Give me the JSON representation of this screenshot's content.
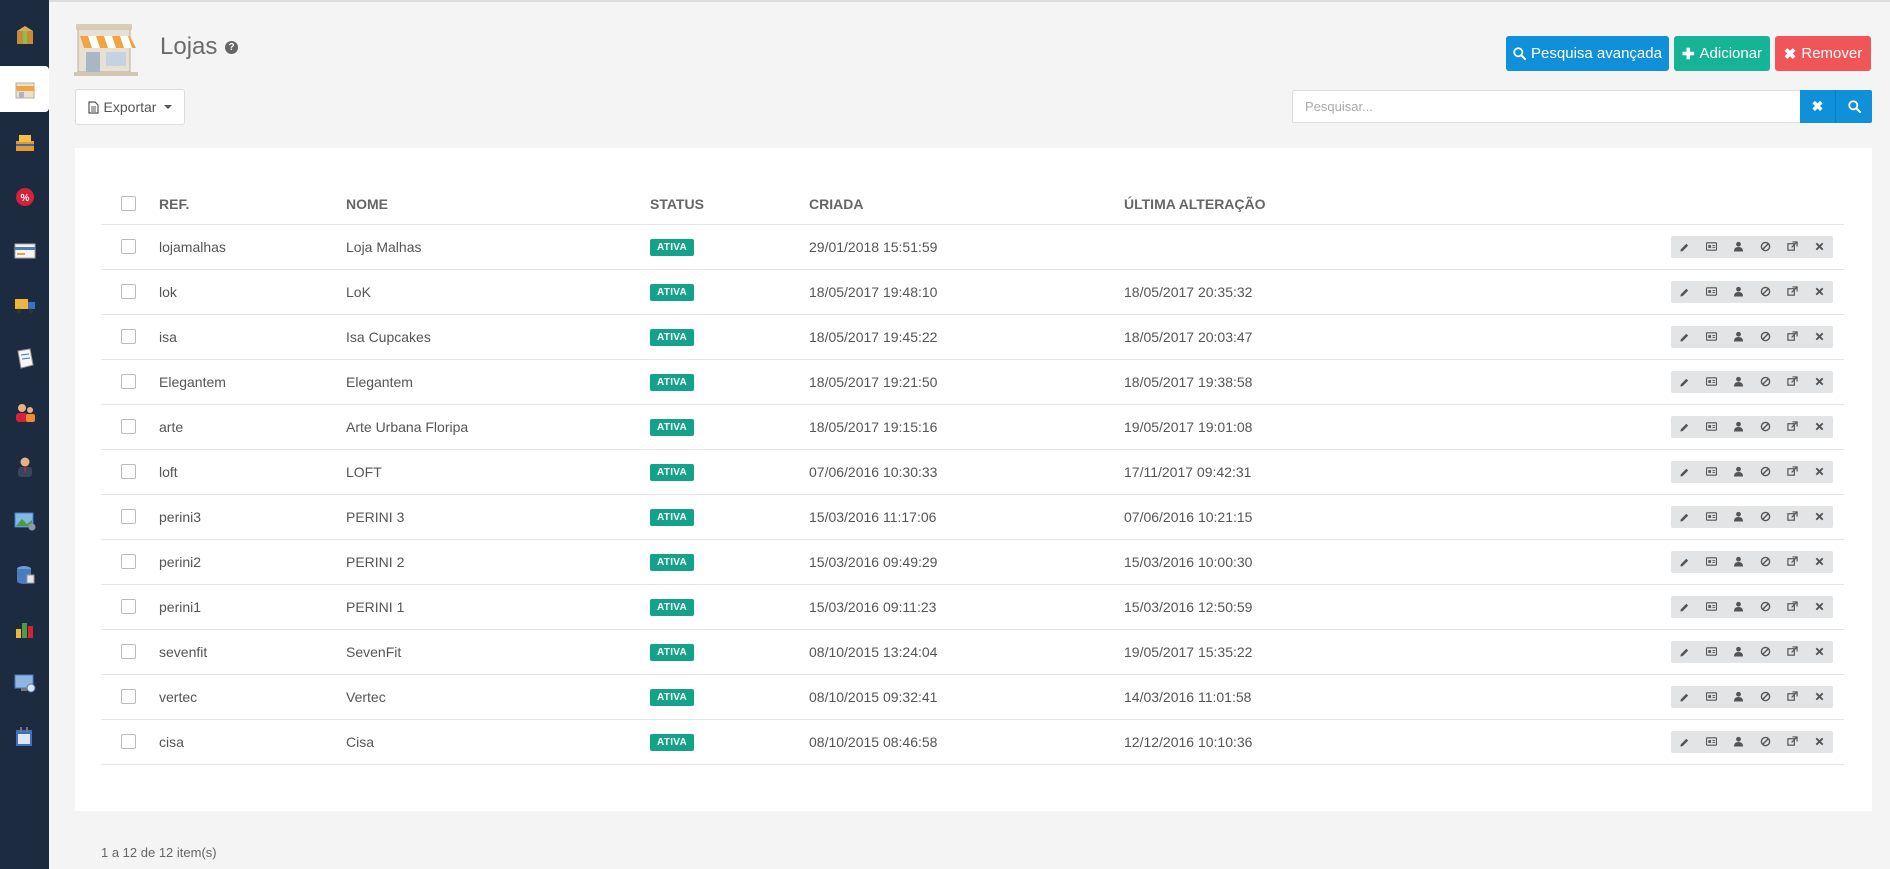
{
  "page": {
    "title": "Lojas",
    "help_glyph": "?"
  },
  "toolbar": {
    "search_advanced_label": "Pesquisa avançada",
    "add_label": "Adicionar",
    "remove_label": "Remover",
    "export_label": "Exportar",
    "search_placeholder": "Pesquisar..."
  },
  "sidebar": {
    "items": [
      {
        "icon": "box-icon"
      },
      {
        "icon": "store-icon",
        "active": true
      },
      {
        "icon": "packages-icon"
      },
      {
        "icon": "discount-icon"
      },
      {
        "icon": "card-icon"
      },
      {
        "icon": "truck-icon"
      },
      {
        "icon": "document-icon"
      },
      {
        "icon": "users-icon"
      },
      {
        "icon": "user-icon"
      },
      {
        "icon": "image-settings-icon"
      },
      {
        "icon": "database-icon"
      },
      {
        "icon": "chart-icon"
      },
      {
        "icon": "monitor-icon"
      },
      {
        "icon": "calendar-icon"
      }
    ]
  },
  "table": {
    "columns": [
      "REF.",
      "NOME",
      "STATUS",
      "CRIADA",
      "ÚLTIMA ALTERAÇÃO"
    ],
    "rows": [
      {
        "ref": "lojamalhas",
        "nome": "Loja Malhas",
        "status": "ATIVA",
        "criada": "29/01/2018 15:51:59",
        "ultima": ""
      },
      {
        "ref": "lok",
        "nome": "LoK",
        "status": "ATIVA",
        "criada": "18/05/2017 19:48:10",
        "ultima": "18/05/2017 20:35:32"
      },
      {
        "ref": "isa",
        "nome": "Isa Cupcakes",
        "status": "ATIVA",
        "criada": "18/05/2017 19:45:22",
        "ultima": "18/05/2017 20:03:47"
      },
      {
        "ref": "Elegantem",
        "nome": "Elegantem",
        "status": "ATIVA",
        "criada": "18/05/2017 19:21:50",
        "ultima": "18/05/2017 19:38:58"
      },
      {
        "ref": "arte",
        "nome": "Arte Urbana Floripa",
        "status": "ATIVA",
        "criada": "18/05/2017 19:15:16",
        "ultima": "19/05/2017 19:01:08"
      },
      {
        "ref": "loft",
        "nome": "LOFT",
        "status": "ATIVA",
        "criada": "07/06/2016 10:30:33",
        "ultima": "17/11/2017 09:42:31"
      },
      {
        "ref": "perini3",
        "nome": "PERINI 3",
        "status": "ATIVA",
        "criada": "15/03/2016 11:17:06",
        "ultima": "07/06/2016 10:21:15"
      },
      {
        "ref": "perini2",
        "nome": "PERINI 2",
        "status": "ATIVA",
        "criada": "15/03/2016 09:49:29",
        "ultima": "15/03/2016 10:00:30"
      },
      {
        "ref": "perini1",
        "nome": "PERINI 1",
        "status": "ATIVA",
        "criada": "15/03/2016 09:11:23",
        "ultima": "15/03/2016 12:50:59"
      },
      {
        "ref": "sevenfit",
        "nome": "SevenFit",
        "status": "ATIVA",
        "criada": "08/10/2015 13:24:04",
        "ultima": "19/05/2017 15:35:22"
      },
      {
        "ref": "vertec",
        "nome": "Vertec",
        "status": "ATIVA",
        "criada": "08/10/2015 09:32:41",
        "ultima": "14/03/2016 11:01:58"
      },
      {
        "ref": "cisa",
        "nome": "Cisa",
        "status": "ATIVA",
        "criada": "08/10/2015 08:46:58",
        "ultima": "12/12/2016 10:10:36"
      }
    ],
    "row_actions": [
      "edit-icon",
      "id-card-icon",
      "user-icon",
      "ban-icon",
      "external-link-icon",
      "close-icon"
    ]
  },
  "footer": {
    "pagination_text": "1 a 12 de 12 item(s)"
  },
  "colors": {
    "sidebar_bg": "#1c2b3f",
    "primary": "#0f90d9",
    "success": "#15b497",
    "danger": "#f05557",
    "badge": "#15a28a"
  }
}
